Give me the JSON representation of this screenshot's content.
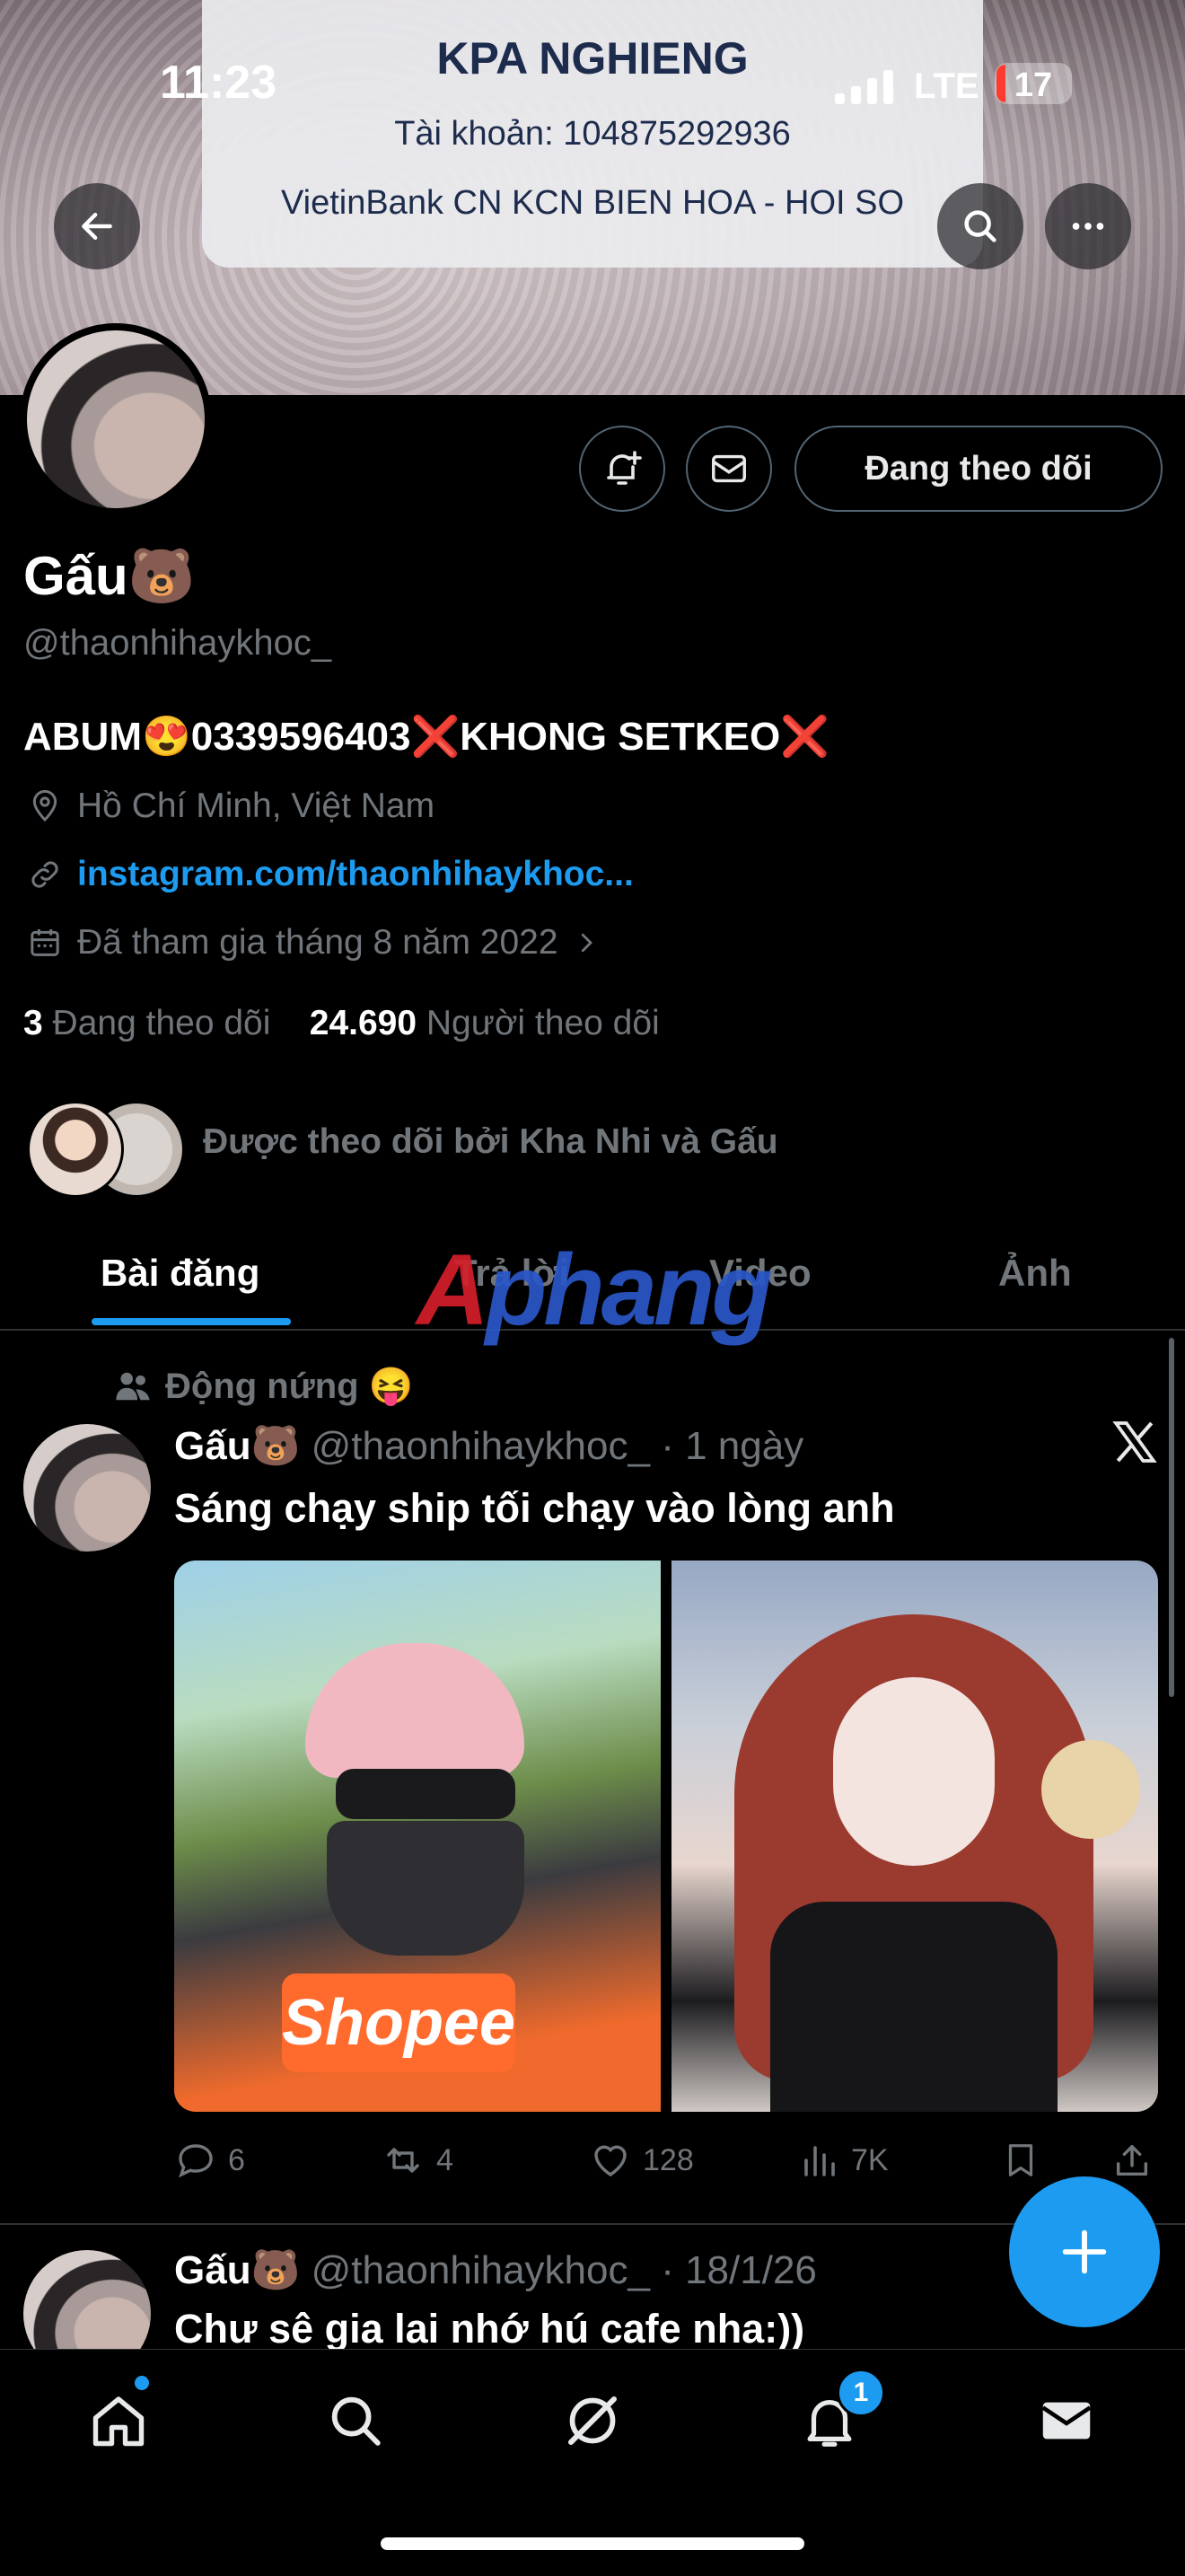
{
  "status_bar": {
    "time": "11:23",
    "network": "LTE",
    "battery": "17"
  },
  "banner_overlay": {
    "title": "KPA NGHIENG",
    "account": "Tài khoản:  104875292936",
    "bank": "VietinBank CN KCN BIEN HOA - HOI SO"
  },
  "profile": {
    "display_name": "Gấu🐻",
    "handle": "@thaonhihaykhoc_",
    "follow_button": "Đang theo dõi",
    "bio": "ABUM😍0339596403❌KHONG SETKEO❌",
    "location": "Hồ Chí Minh, Việt Nam",
    "link": "instagram.com/thaonhihaykhoc...",
    "joined": "Đã tham gia tháng 8 năm 2022",
    "following_count": "3",
    "following_label": "Đang theo dõi",
    "followers_count": "24.690",
    "followers_label": "Người theo dõi",
    "followed_by": "Được theo dõi bởi Kha Nhi và Gấu"
  },
  "tabs": [
    "Bài đăng",
    "Trả lời",
    "Video",
    "Ảnh"
  ],
  "watermark": {
    "part1": "A",
    "part2": "phang"
  },
  "posts": [
    {
      "context": "Động nứng 😝",
      "name": "Gấu🐻",
      "handle": "@thaonhihaykhoc_",
      "time": "· 1 ngày",
      "text": "Sáng chạy ship tối chạy vào lòng anh",
      "image1_label": "Shopee",
      "replies": "6",
      "reposts": "4",
      "likes": "128",
      "views": "7K"
    },
    {
      "name": "Gấu🐻",
      "handle": "@thaonhihaykhoc_",
      "time": "· 18/1/26",
      "text": "Chư sê gia lai nhớ hú cafe nha:))"
    }
  ],
  "notifications_badge": "1",
  "colors": {
    "accent": "#1d9bf0",
    "background": "#000000",
    "muted": "#71767b"
  }
}
